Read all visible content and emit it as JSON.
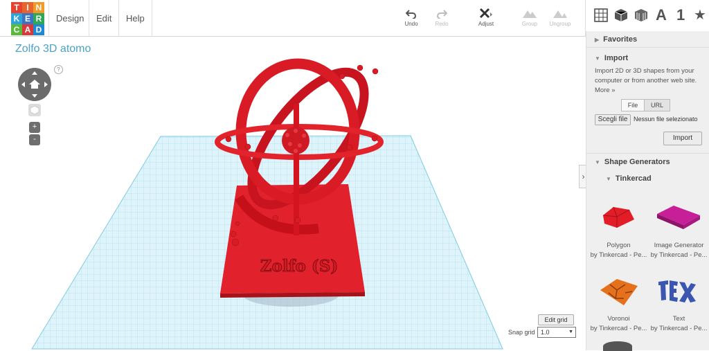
{
  "app": {
    "logo_letters": [
      "T",
      "I",
      "N",
      "K",
      "E",
      "R",
      "C",
      "A",
      "D"
    ],
    "logo_colors": [
      "#e7412f",
      "#e8642f",
      "#f19a2a",
      "#2da5dc",
      "#3a74c4",
      "#2fa856",
      "#5aba3c",
      "#d9393a",
      "#1f88d1"
    ],
    "accent": "#4aa3c8"
  },
  "menu": {
    "design": "Design",
    "edit": "Edit",
    "help": "Help"
  },
  "toolbar": {
    "undo": "Undo",
    "redo": "Redo",
    "adjust": "Adjust",
    "group": "Group",
    "ungroup": "Ungroup"
  },
  "view_tools": {
    "text_icon": "A",
    "number_icon": "1",
    "star_icon": "★"
  },
  "canvas": {
    "design_title": "Zolfo 3D atomo",
    "model_label": "Zolfo (S)",
    "help_glyph": "?",
    "zoom_in": "+",
    "zoom_out": "-"
  },
  "panel": {
    "favorites": "Favorites",
    "import": {
      "title": "Import",
      "description": "Import 2D or 3D shapes from your computer or from another web site.",
      "more": "More »",
      "tab_file": "File",
      "tab_url": "URL",
      "choose_file": "Scegli file",
      "no_file": "Nessun file selezionato",
      "import_button": "Import"
    },
    "shape_generators": "Shape Generators",
    "tinkercad": "Tinkercad",
    "shapes": [
      {
        "name": "Polygon",
        "author": "by Tinkercad - Pe..."
      },
      {
        "name": "Image Generator",
        "author": "by Tinkercad - Pe..."
      },
      {
        "name": "Voronoi",
        "author": "by Tinkercad - Pe..."
      },
      {
        "name": "Text",
        "author": "by Tinkercad - Pe..."
      }
    ]
  },
  "grid": {
    "edit_grid": "Edit grid",
    "snap_label": "Snap grid",
    "snap_value": "1.0"
  }
}
